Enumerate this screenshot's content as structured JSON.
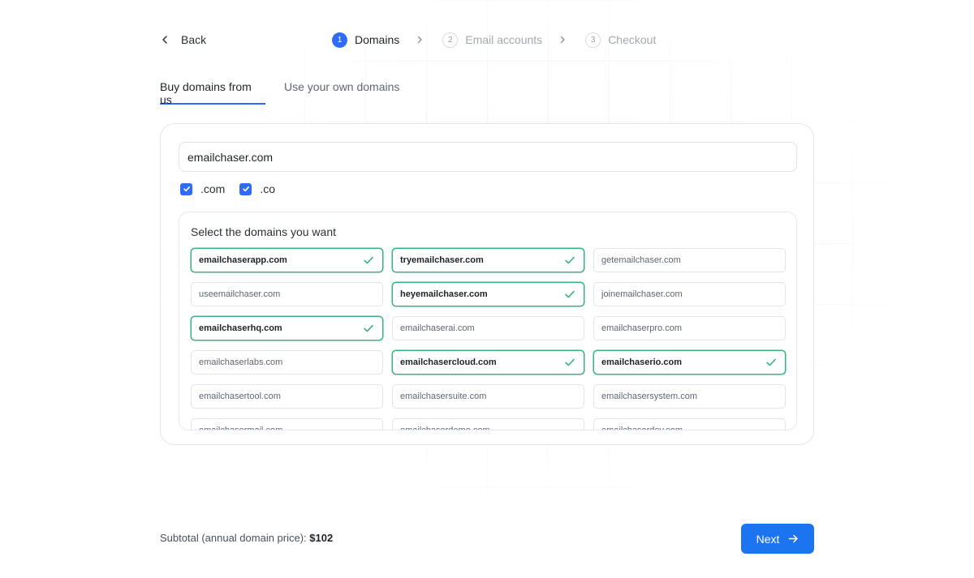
{
  "header": {
    "back_label": "Back",
    "steps": [
      {
        "number": "1",
        "label": "Domains",
        "state": "active"
      },
      {
        "number": "2",
        "label": "Email accounts",
        "state": "inactive"
      },
      {
        "number": "3",
        "label": "Checkout",
        "state": "inactive"
      }
    ]
  },
  "tabs": [
    {
      "label": "Buy domains from us",
      "active": true
    },
    {
      "label": "Use your own domains",
      "active": false
    }
  ],
  "search": {
    "value": "emailchaser.com"
  },
  "tlds": [
    {
      "label": ".com",
      "checked": true
    },
    {
      "label": ".co",
      "checked": true
    }
  ],
  "picker": {
    "title": "Select the domains you want",
    "domains": [
      {
        "name": "emailchaserapp.com",
        "selected": true
      },
      {
        "name": "tryemailchaser.com",
        "selected": true
      },
      {
        "name": "getemailchaser.com",
        "selected": false
      },
      {
        "name": "useemailchaser.com",
        "selected": false
      },
      {
        "name": "heyemailchaser.com",
        "selected": true
      },
      {
        "name": "joinemailchaser.com",
        "selected": false
      },
      {
        "name": "emailchaserhq.com",
        "selected": true
      },
      {
        "name": "emailchaserai.com",
        "selected": false
      },
      {
        "name": "emailchaserpro.com",
        "selected": false
      },
      {
        "name": "emailchaserlabs.com",
        "selected": false
      },
      {
        "name": "emailchasercloud.com",
        "selected": true
      },
      {
        "name": "emailchaserio.com",
        "selected": true
      },
      {
        "name": "emailchasertool.com",
        "selected": false
      },
      {
        "name": "emailchasersuite.com",
        "selected": false
      },
      {
        "name": "emailchasersystem.com",
        "selected": false
      },
      {
        "name": "emailchasermail.com",
        "selected": false
      },
      {
        "name": "emailchaserdemo.com",
        "selected": false
      },
      {
        "name": "emailchaserdev.com",
        "selected": false
      }
    ]
  },
  "footer": {
    "subtotal_label": "Subtotal (annual domain price):",
    "subtotal_value": "$102",
    "next_label": "Next"
  },
  "colors": {
    "accent": "#2f6bf5",
    "button": "#1d74f0",
    "selected_border": "#36b37e"
  },
  "icons": {
    "back": "chevron-left-icon",
    "step_separator": "chevron-right-icon",
    "checkbox": "checkmark-icon",
    "selected_domain": "check-icon",
    "next": "arrow-right-icon"
  }
}
